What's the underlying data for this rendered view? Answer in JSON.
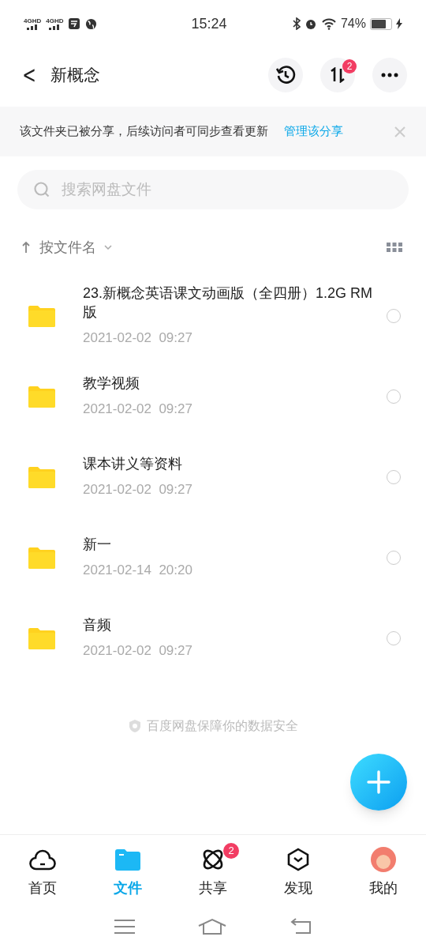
{
  "status_bar": {
    "networks": [
      "4GHD",
      "4GHD"
    ],
    "time": "15:24",
    "battery": "74%"
  },
  "header": {
    "back": "<",
    "title": "新概念",
    "transfer_badge": "2"
  },
  "banner": {
    "text": "该文件夹已被分享，后续访问者可同步查看更新",
    "link": "管理该分享"
  },
  "search": {
    "placeholder": "搜索网盘文件"
  },
  "sort": {
    "label": "按文件名"
  },
  "files": [
    {
      "name": "23.新概念英语课文动画版（全四册）1.2G RM版",
      "date": "2021-02-02  09:27",
      "checked": false
    },
    {
      "name": "教学视频",
      "date": "2021-02-02  09:27",
      "checked": false
    },
    {
      "name": "课本讲义等资料",
      "date": "2021-02-02  09:27",
      "checked": false
    },
    {
      "name": "新一",
      "date": "2021-02-14  20:20",
      "checked": false
    },
    {
      "name": "音频",
      "date": "2021-02-02  09:27",
      "checked": false
    }
  ],
  "footer_note": "百度网盘保障你的数据安全",
  "tabs": [
    {
      "kind": "cloud",
      "label": "首页",
      "selected": false
    },
    {
      "kind": "folder",
      "label": "文件",
      "selected": true
    },
    {
      "kind": "atom",
      "label": "共享",
      "selected": false,
      "badge": "2"
    },
    {
      "kind": "cube",
      "label": "发现",
      "selected": false
    },
    {
      "kind": "avatar",
      "label": "我的",
      "selected": false
    }
  ]
}
